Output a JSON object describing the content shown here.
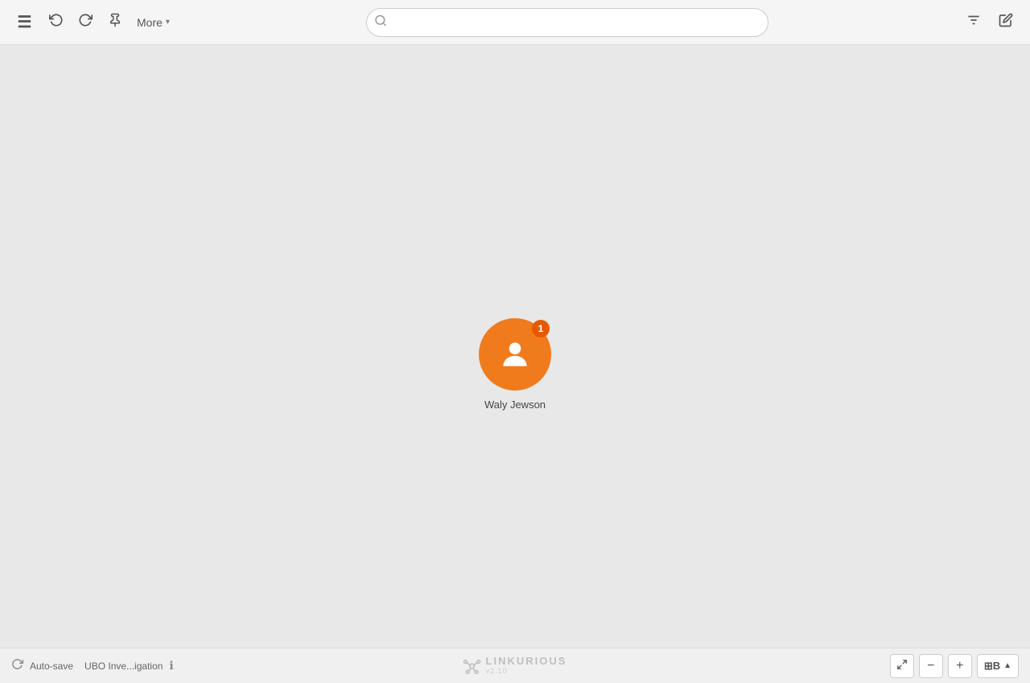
{
  "toolbar": {
    "menu_label": "≡",
    "undo_label": "↩",
    "redo_label": "↪",
    "pin_label": "📌",
    "more_label": "More",
    "more_chevron": "▾",
    "filter_label": "⚙",
    "edit_label": "✏"
  },
  "search": {
    "placeholder": ""
  },
  "canvas": {
    "node": {
      "label": "Waly Jewson",
      "badge_count": "1",
      "color": "#f07b1d"
    }
  },
  "bottombar": {
    "autosave_icon": "↻",
    "autosave_label": "Auto-save",
    "investigation_label": "UBO Inve...igation",
    "info_label": "ℹ",
    "logo_text": "LINKURIOUS",
    "logo_sub": "v2.10",
    "fit_icon": "⛶",
    "zoom_minus": "−",
    "zoom_plus": "+",
    "layout_label": "⊞B",
    "layout_chevron": "▲"
  },
  "icons": {
    "hamburger": "≡",
    "undo": "↩",
    "redo": "↪",
    "pin": "📌",
    "filter": "⚙",
    "edit": "✏",
    "search": "🔍",
    "info": "ℹ",
    "autosave": "↻",
    "fit": "⛶",
    "chevron_down": "▾",
    "chevron_up": "▲",
    "zoom_minus": "−",
    "zoom_plus": "+"
  }
}
